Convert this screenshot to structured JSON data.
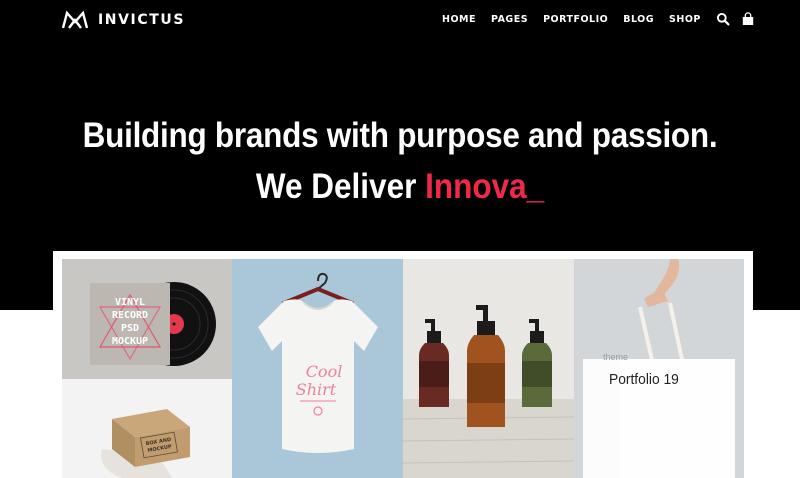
{
  "brand": {
    "name": "INVICTUS"
  },
  "nav": {
    "items": [
      {
        "label": "HOME"
      },
      {
        "label": "PAGES"
      },
      {
        "label": "PORTFOLIO"
      },
      {
        "label": "BLOG"
      },
      {
        "label": "SHOP"
      }
    ],
    "icons": [
      "search-icon",
      "cart-icon"
    ]
  },
  "hero": {
    "headline": "Building brands with purpose and passion.",
    "typed_lead": "We Deliver ",
    "typed_word": "Innova",
    "typed_cursor": "_",
    "accent_color": "#f0284a"
  },
  "portfolio": {
    "tiles": [
      {
        "name": "vinyl-record-mockup",
        "art_text": [
          "VINYL",
          "RECORD",
          "PSD",
          "MOCKUP"
        ]
      },
      {
        "name": "box-mockup",
        "art_text": [
          "BOX AND",
          "MOCKUP"
        ]
      },
      {
        "name": "cool-shirt-mockup",
        "art_text": [
          "Cool",
          "Shirt"
        ]
      },
      {
        "name": "bottles-mockup",
        "art_text": []
      },
      {
        "name": "tote-bag-mockup",
        "art_text": []
      }
    ],
    "hover_card": {
      "caption": "theme",
      "title": "Portfolio 19"
    }
  }
}
